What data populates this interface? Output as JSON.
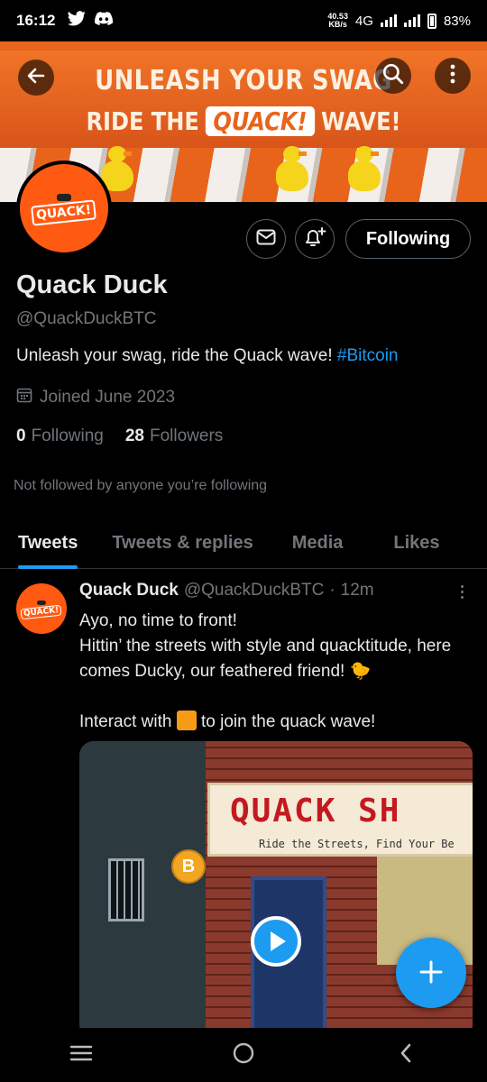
{
  "status": {
    "time": "16:12",
    "net_speed": "40.53",
    "net_unit": "KB/s",
    "network": "4G",
    "battery": "83%"
  },
  "banner": {
    "line1": "UNLEASH YOUR SWAG",
    "line2_pre": "RIDE THE",
    "line2_brand": "QUACK!",
    "line2_post": "WAVE!"
  },
  "profile": {
    "avatar_text": "QUACK!",
    "name": "Quack Duck",
    "handle": "@QuackDuckBTC",
    "bio_text": "Unleash your swag, ride the Quack wave! ",
    "bio_hashtag": "#Bitcoin",
    "joined": "Joined June 2023",
    "following_count": "0",
    "following_label": "Following",
    "followers_count": "28",
    "followers_label": "Followers",
    "not_followed": "Not followed by anyone you’re following",
    "follow_button": "Following"
  },
  "tabs": [
    {
      "label": "Tweets",
      "active": true
    },
    {
      "label": "Tweets & replies",
      "active": false
    },
    {
      "label": "Media",
      "active": false
    },
    {
      "label": "Likes",
      "active": false
    }
  ],
  "tweet": {
    "avatar_text": "QUACK!",
    "name": "Quack Duck",
    "handle": "@QuackDuckBTC",
    "sep": "·",
    "time": "12m",
    "line1": "Ayo, no time to front!",
    "line2": "Hittin’ the streets with style and quacktitude, here comes Ducky, our feathered friend! 🐤",
    "line3_pre": "Interact with",
    "line3_post": "to join the quack wave!",
    "media_sign_title": "QUACK SH",
    "media_sign_sub": "Ride the Streets, Find Your Be",
    "media_coin": "B"
  },
  "colors": {
    "accent": "#1d9bf0",
    "brand_orange": "#ff5a12",
    "muted": "#71767b"
  },
  "icons": {
    "back": "arrow-left-icon",
    "search": "search-icon",
    "more": "more-vertical-icon",
    "message": "envelope-icon",
    "notify": "bell-plus-icon",
    "calendar": "calendar-icon",
    "compose": "plus-icon"
  }
}
